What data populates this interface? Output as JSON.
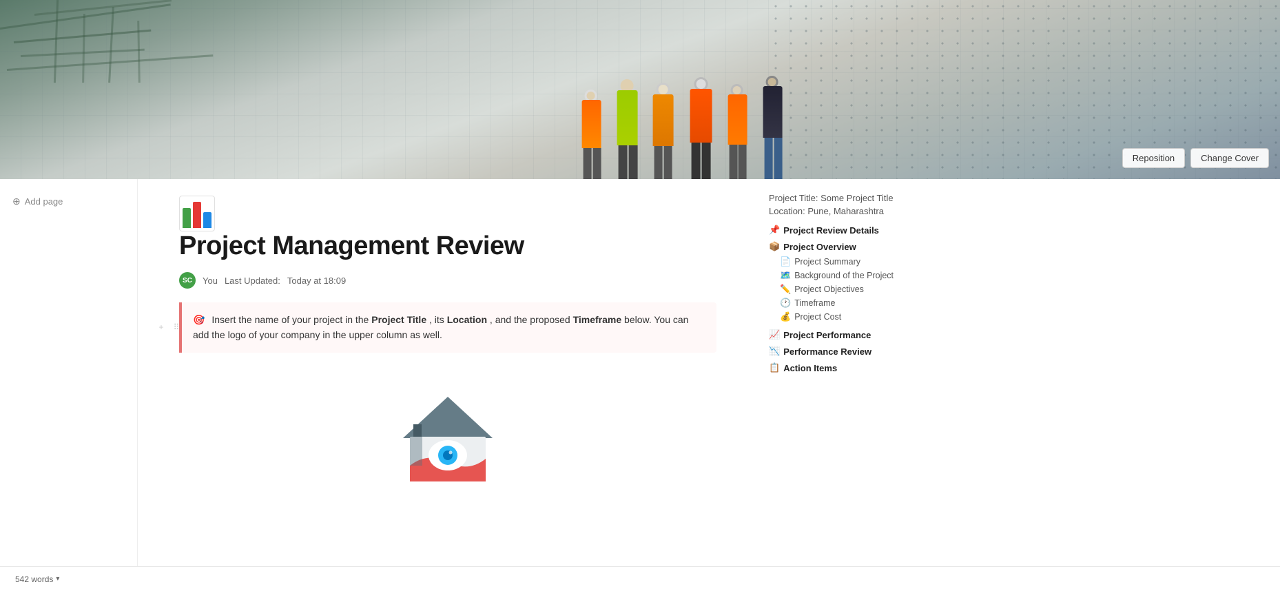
{
  "cover": {
    "reposition_label": "Reposition",
    "change_cover_label": "Change Cover"
  },
  "left_sidebar": {
    "add_page_label": "Add page"
  },
  "page": {
    "title": "Project Management Review",
    "meta": {
      "author_label": "You",
      "author_initials": "SC",
      "last_updated_label": "Last Updated:",
      "last_updated_value": "Today at 18:09"
    },
    "callout": {
      "icon": "🎯",
      "text_before_bold1": "Insert the name of your project in the ",
      "bold1": "Project Title",
      "text_between": ", its ",
      "bold2": "Location",
      "text_after": ", and the proposed ",
      "bold3": "Timeframe",
      "text_end": " below. You can add the logo of your company in the upper column as well."
    }
  },
  "right_sidebar": {
    "project_title_label": "Project Title: Some Project Title",
    "location_label": "Location: Pune, Maharashtra",
    "sections": [
      {
        "icon": "📌",
        "label": "Project Review Details",
        "items": []
      },
      {
        "icon": "📦",
        "label": "Project Overview",
        "items": [
          {
            "icon": "📄",
            "label": "Project Summary"
          },
          {
            "icon": "🗺️",
            "label": "Background of the Project"
          },
          {
            "icon": "✏️",
            "label": "Project Objectives"
          },
          {
            "icon": "🕐",
            "label": "Timeframe"
          },
          {
            "icon": "💰",
            "label": "Project Cost"
          }
        ]
      },
      {
        "icon": "📈",
        "label": "Project Performance",
        "items": []
      },
      {
        "icon": "📉",
        "label": "Performance Review",
        "items": []
      },
      {
        "icon": "📋",
        "label": "Action Items",
        "items": []
      }
    ]
  },
  "footer": {
    "word_count": "542 words"
  }
}
